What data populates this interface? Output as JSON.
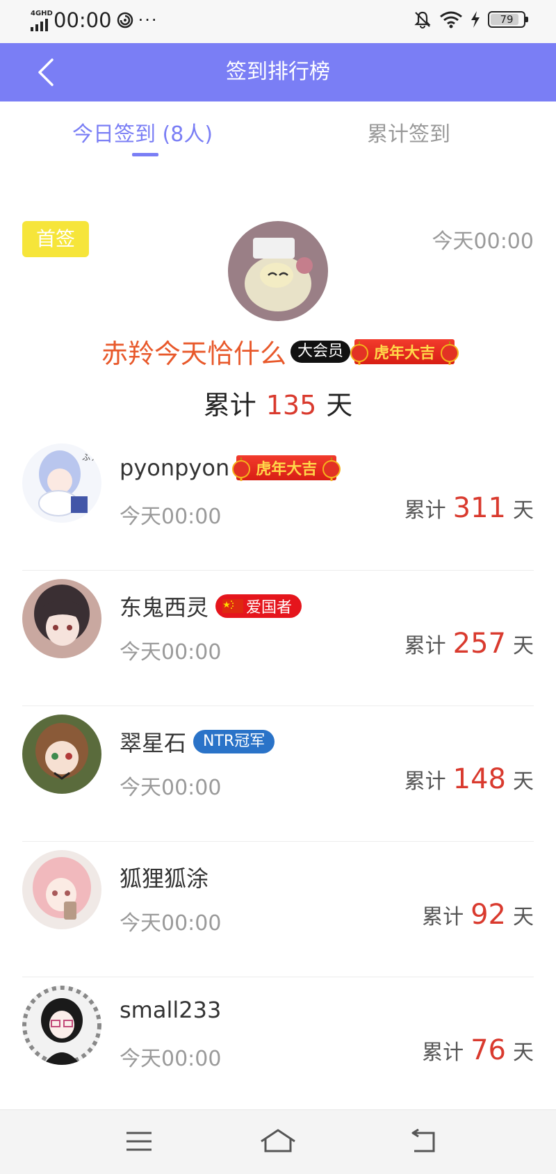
{
  "status_bar": {
    "network": "4GHD",
    "time": "00:00",
    "dots": "···",
    "battery": "79"
  },
  "header": {
    "title": "签到排行榜",
    "back_icon": "chevron-left-icon"
  },
  "tabs": [
    {
      "label": "今日签到 (8人)",
      "active": true
    },
    {
      "label": "累计签到",
      "active": false
    }
  ],
  "first": {
    "badge": "首签",
    "time": "今天00:00",
    "name": "赤羚今天恰什么",
    "vip_badge": "大会员",
    "tiger_badge": "虎年大吉",
    "total_prefix": "累计",
    "total_days": "135",
    "total_suffix": "天"
  },
  "entries": [
    {
      "name": "pyonpyon",
      "time": "今天00:00",
      "prefix": "累计",
      "days": "311",
      "suffix": "天",
      "badge": "虎年大吉"
    },
    {
      "name": "东鬼西灵",
      "time": "今天00:00",
      "prefix": "累计",
      "days": "257",
      "suffix": "天",
      "badge": "爱国者"
    },
    {
      "name": "翠星石",
      "time": "今天00:00",
      "prefix": "累计",
      "days": "148",
      "suffix": "天",
      "badge": "NTR冠军"
    },
    {
      "name": "狐狸狐涂",
      "time": "今天00:00",
      "prefix": "累计",
      "days": "92",
      "suffix": "天"
    },
    {
      "name": "small233",
      "time": "今天00:00",
      "prefix": "累计",
      "days": "76",
      "suffix": "天"
    }
  ],
  "colors": {
    "accent": "#7a7ef5",
    "first_name": "#e8592b",
    "count_red": "#d93a2e",
    "first_badge": "#f6e53a"
  }
}
